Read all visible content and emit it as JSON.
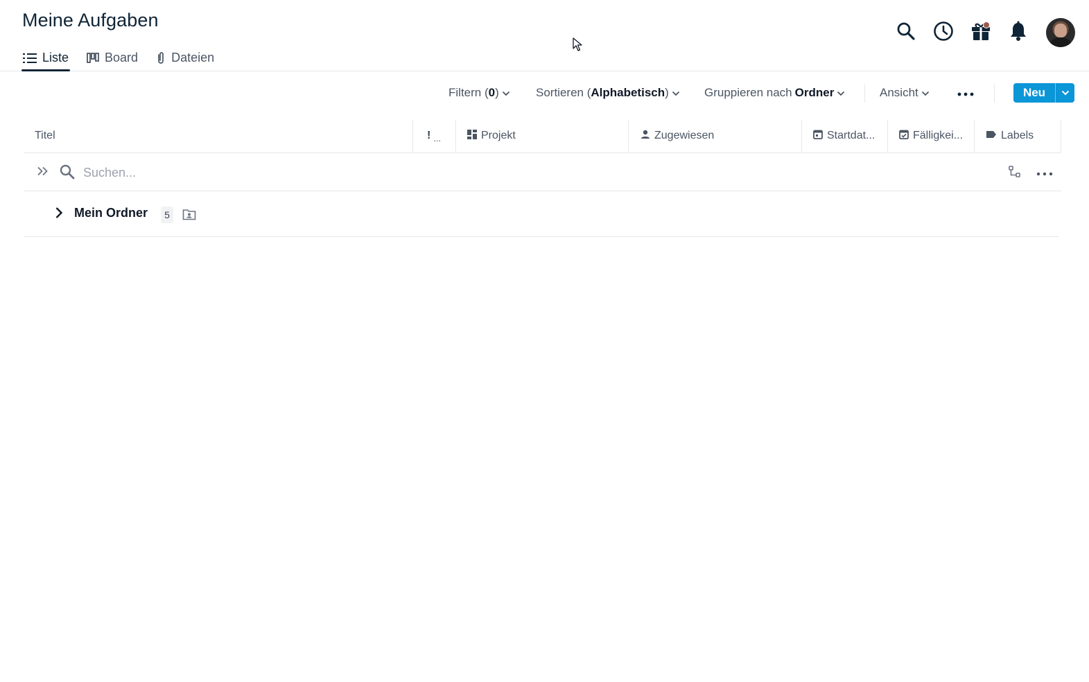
{
  "header": {
    "title": "Meine Aufgaben",
    "tabs": [
      {
        "label": "Liste",
        "icon": "list-icon",
        "active": true
      },
      {
        "label": "Board",
        "icon": "board-icon",
        "active": false
      },
      {
        "label": "Dateien",
        "icon": "paperclip-icon",
        "active": false
      }
    ],
    "actions": [
      "search-icon",
      "clock-icon",
      "gift-icon",
      "bell-icon",
      "avatar"
    ]
  },
  "toolbar": {
    "filter_label": "Filtern (",
    "filter_count": "0",
    "filter_close": ")",
    "sort_label": "Sortieren (",
    "sort_value": "Alphabetisch",
    "sort_close": ")",
    "group_label": "Gruppieren nach",
    "group_value": "Ordner",
    "view_label": "Ansicht",
    "new_label": "Neu"
  },
  "table": {
    "columns": {
      "title": "Titel",
      "priority": "!",
      "priority_more": "...",
      "project": "Projekt",
      "assigned": "Zugewiesen",
      "start_date": "Startdat...",
      "due_date": "Fälligkei...",
      "labels": "Labels"
    },
    "search": {
      "placeholder": "Suchen...",
      "value": ""
    },
    "groups": [
      {
        "label": "Mein Ordner",
        "count": "5",
        "expanded": false
      }
    ]
  },
  "colors": {
    "primary": "#0b96d8",
    "title": "#0f2436",
    "border": "#e5e7eb",
    "notification_dot": "#a05a4a"
  }
}
